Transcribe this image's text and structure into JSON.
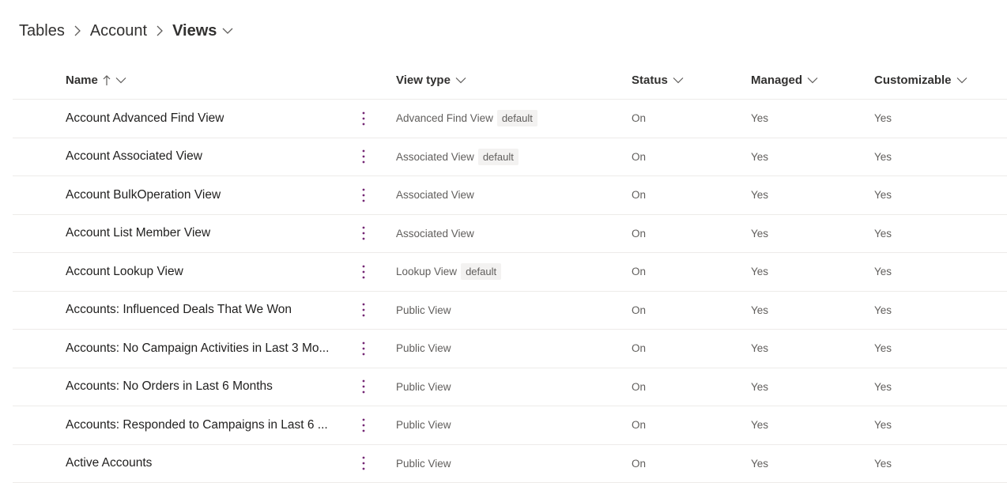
{
  "breadcrumb": {
    "items": [
      "Tables",
      "Account"
    ],
    "current": "Views"
  },
  "columns": {
    "name": "Name",
    "view_type": "View type",
    "status": "Status",
    "managed": "Managed",
    "customizable": "Customizable"
  },
  "sort": {
    "column": "name",
    "direction": "ascending",
    "icon": "arrow-up-icon"
  },
  "colors": {
    "accent": "#742774",
    "text": "#323130",
    "muted": "#605e5c",
    "divider": "#edebe9",
    "badge_bg": "#f3f2f1"
  },
  "rows": [
    {
      "name": "Account Advanced Find View",
      "view_type": "Advanced Find View",
      "badge": "default",
      "status": "On",
      "managed": "Yes",
      "customizable": "Yes"
    },
    {
      "name": "Account Associated View",
      "view_type": "Associated View",
      "badge": "default",
      "status": "On",
      "managed": "Yes",
      "customizable": "Yes"
    },
    {
      "name": "Account BulkOperation View",
      "view_type": "Associated View",
      "badge": "",
      "status": "On",
      "managed": "Yes",
      "customizable": "Yes"
    },
    {
      "name": "Account List Member View",
      "view_type": "Associated View",
      "badge": "",
      "status": "On",
      "managed": "Yes",
      "customizable": "Yes"
    },
    {
      "name": "Account Lookup View",
      "view_type": "Lookup View",
      "badge": "default",
      "status": "On",
      "managed": "Yes",
      "customizable": "Yes"
    },
    {
      "name": "Accounts: Influenced Deals That We Won",
      "view_type": "Public View",
      "badge": "",
      "status": "On",
      "managed": "Yes",
      "customizable": "Yes"
    },
    {
      "name": "Accounts: No Campaign Activities in Last 3 Mo...",
      "view_type": "Public View",
      "badge": "",
      "status": "On",
      "managed": "Yes",
      "customizable": "Yes"
    },
    {
      "name": "Accounts: No Orders in Last 6 Months",
      "view_type": "Public View",
      "badge": "",
      "status": "On",
      "managed": "Yes",
      "customizable": "Yes"
    },
    {
      "name": "Accounts: Responded to Campaigns in Last 6 ...",
      "view_type": "Public View",
      "badge": "",
      "status": "On",
      "managed": "Yes",
      "customizable": "Yes"
    },
    {
      "name": "Active Accounts",
      "view_type": "Public View",
      "badge": "",
      "status": "On",
      "managed": "Yes",
      "customizable": "Yes"
    }
  ]
}
